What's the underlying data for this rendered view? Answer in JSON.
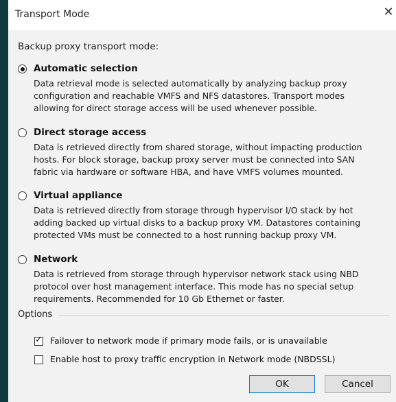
{
  "window": {
    "title": "Transport Mode",
    "close_glyph": "✕"
  },
  "section_label": "Backup proxy transport mode:",
  "modes": [
    {
      "title": "Automatic selection",
      "checked": true,
      "lines": [
        "Data retrieval mode is selected automatically by analyzing backup proxy",
        "configuration and reachable VMFS and NFS datastores. Transport modes",
        "allowing for direct storage access will be used whenever possible."
      ]
    },
    {
      "title": "Direct storage access",
      "checked": false,
      "lines": [
        "Data is retrieved directly from shared storage, without impacting production",
        "hosts. For block storage, backup proxy server must be connected into SAN",
        "fabric via hardware or software HBA, and have VMFS volumes mounted."
      ]
    },
    {
      "title": "Virtual appliance",
      "checked": false,
      "lines": [
        "Data is retrieved directly from storage through hypervisor I/O stack by hot",
        "adding backed up virtual disks to a backup proxy VM. Datastores containing",
        "protected VMs must be connected to a host running backup proxy VM."
      ]
    },
    {
      "title": "Network",
      "checked": false,
      "lines": [
        "Data is retrieved from storage through hypervisor network stack using NBD",
        "protocol over host management interface. This mode has no special setup",
        "requirements. Recommended for 10 Gb Ethernet or faster."
      ]
    }
  ],
  "options": {
    "label": "Options",
    "failover": {
      "label": "Failover to network mode if primary mode fails, or is unavailable",
      "checked": true
    },
    "encryption": {
      "label": "Enable host to proxy traffic encryption in Network mode (NBDSSL)",
      "checked": false
    }
  },
  "buttons": {
    "ok": "OK",
    "cancel": "Cancel"
  }
}
